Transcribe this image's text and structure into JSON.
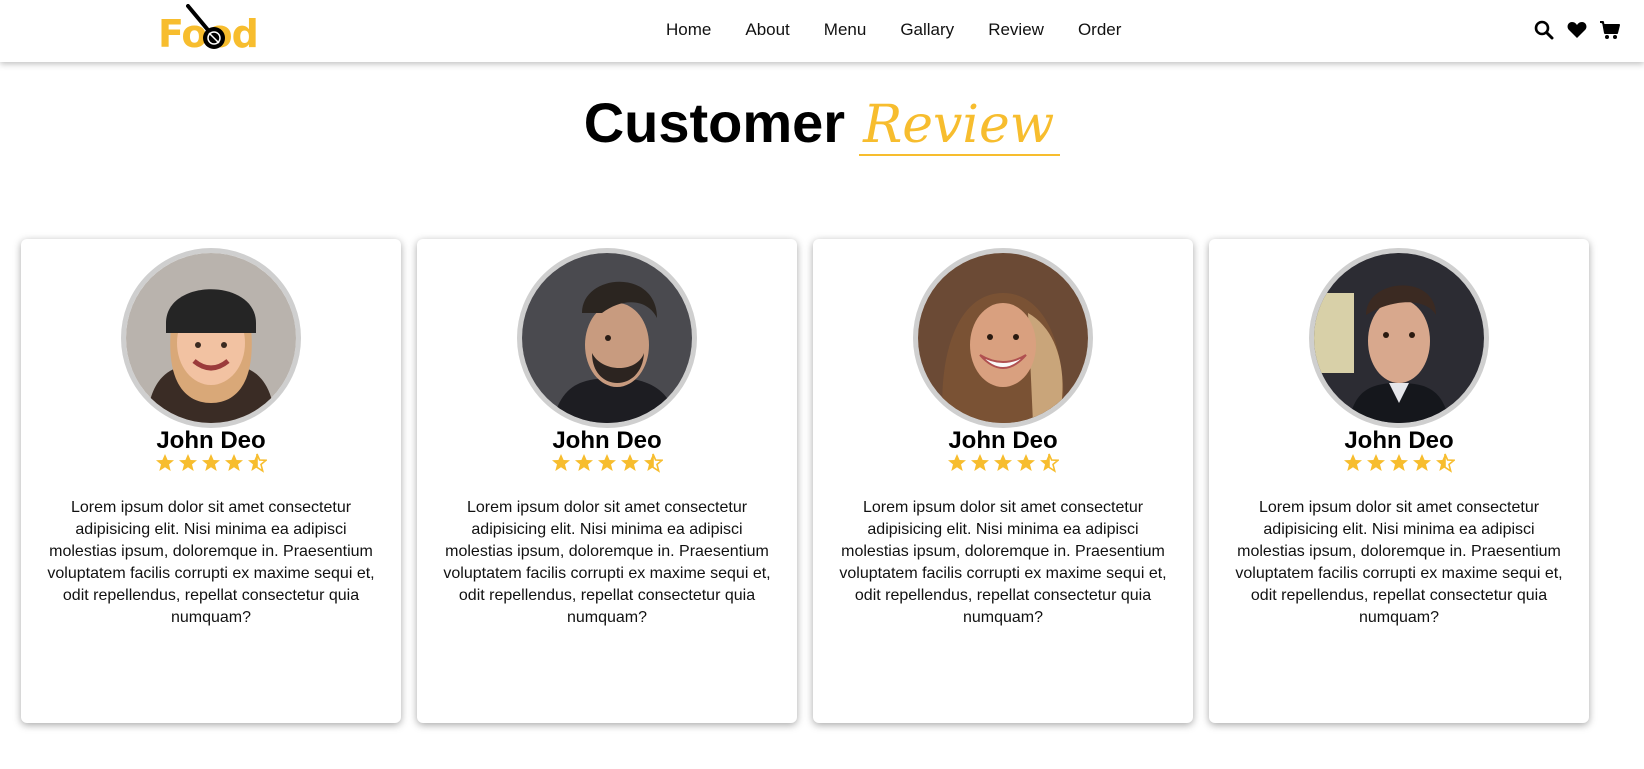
{
  "header": {
    "logo_text": "Food",
    "nav": [
      "Home",
      "About",
      "Menu",
      "Gallary",
      "Review",
      "Order"
    ],
    "icons": [
      "search-icon",
      "heart-icon",
      "cart-icon"
    ]
  },
  "section": {
    "title_main": "Customer",
    "title_accent": "Review"
  },
  "colors": {
    "accent": "#f7bd2e",
    "text": "#000000",
    "card_bg": "#ffffff",
    "avatar_border": "#cfcfcf"
  },
  "reviews": [
    {
      "name": "John Deo",
      "rating": 4.5,
      "text": "Lorem ipsum dolor sit amet consectetur adipisicing elit. Nisi minima ea adipisci molestias ipsum, doloremque in. Praesentium voluptatem facilis corrupti ex maxime sequi et, odit repellendus, repellat consectetur quia numquam?"
    },
    {
      "name": "John Deo",
      "rating": 4.5,
      "text": "Lorem ipsum dolor sit amet consectetur adipisicing elit. Nisi minima ea adipisci molestias ipsum, doloremque in. Praesentium voluptatem facilis corrupti ex maxime sequi et, odit repellendus, repellat consectetur quia numquam?"
    },
    {
      "name": "John Deo",
      "rating": 4.5,
      "text": "Lorem ipsum dolor sit amet consectetur adipisicing elit. Nisi minima ea adipisci molestias ipsum, doloremque in. Praesentium voluptatem facilis corrupti ex maxime sequi et, odit repellendus, repellat consectetur quia numquam?"
    },
    {
      "name": "John Deo",
      "rating": 4.5,
      "text": "Lorem ipsum dolor sit amet consectetur adipisicing elit. Nisi minima ea adipisci molestias ipsum, doloremque in. Praesentium voluptatem facilis corrupti ex maxime sequi et, odit repellendus, repellat consectetur quia numquam?"
    }
  ]
}
